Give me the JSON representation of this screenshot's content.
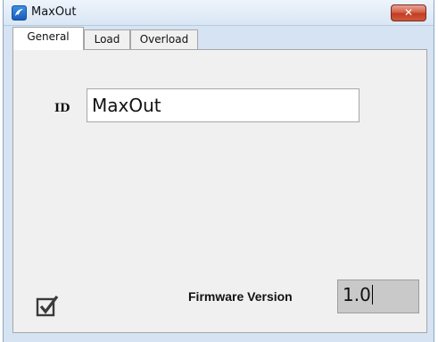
{
  "window": {
    "title": "MaxOut",
    "close_glyph": "✕"
  },
  "tabs": [
    {
      "label": "General",
      "active": true
    },
    {
      "label": "Load",
      "active": false
    },
    {
      "label": "Overload",
      "active": false
    }
  ],
  "general": {
    "id_label": "ID",
    "id_value": "MaxOut",
    "firmware_label": "Firmware Version",
    "firmware_value": "1.0",
    "enabled_checked": true
  },
  "icons": {
    "app": "app-logo-icon",
    "close": "close-icon",
    "checkbox": "checkbox-checked-icon"
  },
  "colors": {
    "frame": "#d5e3f3",
    "close_button": "#c23d23",
    "readonly_field": "#c9c9c9"
  }
}
